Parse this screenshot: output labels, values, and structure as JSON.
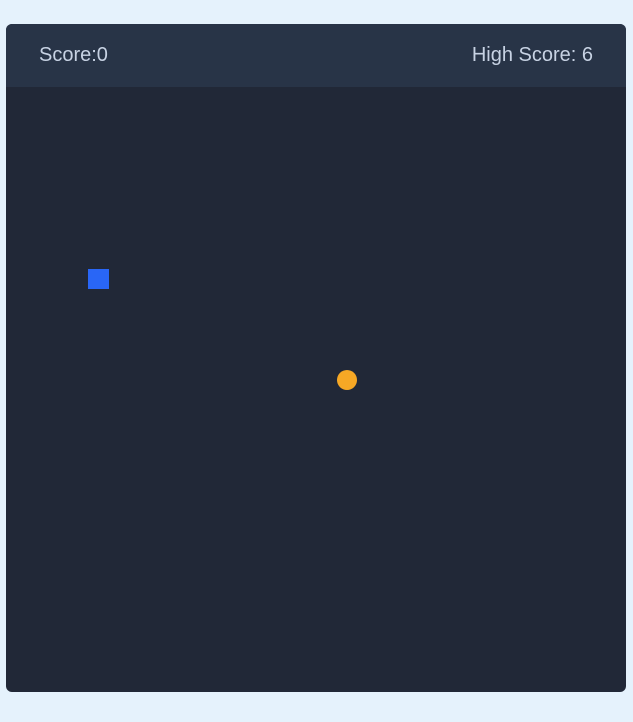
{
  "header": {
    "score_text": "Score:0",
    "high_score_text": "High Score: 6"
  },
  "colors": {
    "page_background": "#E5F2FC",
    "board_background": "#212837",
    "header_background": "#283447",
    "header_text": "#C7D2E3",
    "snake": "#2966F6",
    "food": "#F6A825"
  },
  "game": {
    "score": 0,
    "high_score": 6,
    "snake_length": 1
  }
}
